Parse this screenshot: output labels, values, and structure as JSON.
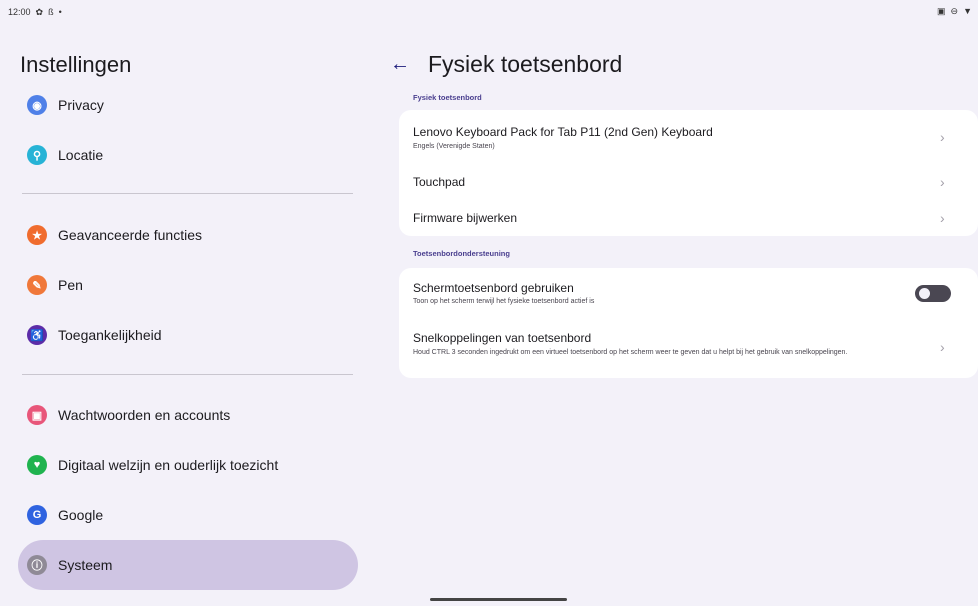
{
  "status_bar": {
    "time": "12:00",
    "left_icons": [
      "gear-icon",
      "bluetooth-icon",
      "dot-icon"
    ],
    "right_icons": [
      "cast-icon",
      "dnd-icon",
      "wifi-icon"
    ]
  },
  "left": {
    "title": "Instellingen",
    "items": [
      {
        "label": "Privacy",
        "icon": "privacy-icon",
        "color": "#4f80e8",
        "glyph": "◉"
      },
      {
        "label": "Locatie",
        "icon": "location-icon",
        "color": "#27b3d6",
        "glyph": "⚲"
      },
      {
        "label": "Geavanceerde functies",
        "icon": "star-icon",
        "color": "#f06c2e",
        "glyph": "★"
      },
      {
        "label": "Pen",
        "icon": "pen-icon",
        "color": "#f0783a",
        "glyph": "✎"
      },
      {
        "label": "Toegankelijkheid",
        "icon": "accessibility-icon",
        "color": "#5c2ca8",
        "glyph": "♿"
      },
      {
        "label": "Wachtwoorden en accounts",
        "icon": "account-icon",
        "color": "#e8567a",
        "glyph": "▣"
      },
      {
        "label": "Digitaal welzijn en ouderlijk toezicht",
        "icon": "wellbeing-icon",
        "color": "#1fb34f",
        "glyph": "♥"
      },
      {
        "label": "Google",
        "icon": "google-icon",
        "color": "#2f63e0",
        "glyph": "G"
      },
      {
        "label": "Systeem",
        "icon": "system-icon",
        "color": "#8f8a96",
        "glyph": "ⓘ"
      }
    ]
  },
  "main": {
    "back_label": "←",
    "title": "Fysiek toetsenbord",
    "section1_label": "Fysiek toetsenbord",
    "keyboard_title": "Lenovo Keyboard Pack for Tab P11 (2nd Gen) Keyboard",
    "keyboard_sub": "Engels (Verenigde Staten)",
    "touchpad": "Touchpad",
    "firmware": "Firmware bijwerken",
    "section2_label": "Toetsenbordondersteuning",
    "onscreen_title": "Schermtoetsenbord gebruiken",
    "onscreen_sub": "Toon op het scherm terwijl het fysieke toetsenbord actief is",
    "onscreen_enabled": false,
    "shortcuts_title": "Snelkoppelingen van toetsenbord",
    "shortcuts_sub": "Houd CTRL 3 seconden ingedrukt om een virtueel toetsenbord op het scherm weer te geven dat u helpt bij het gebruik van snelkoppelingen."
  }
}
